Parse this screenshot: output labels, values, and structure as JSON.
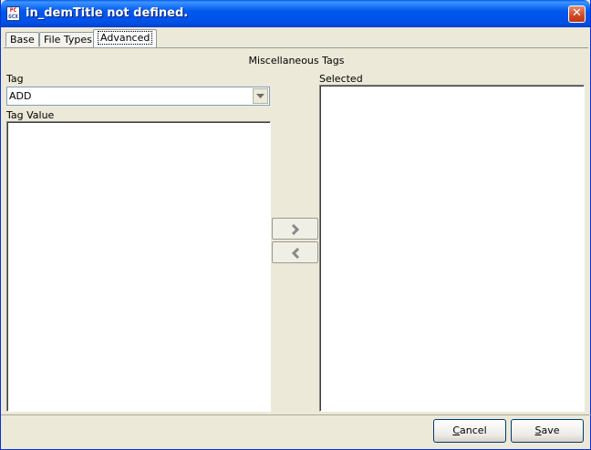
{
  "window": {
    "title": "in_demTitle not defined.",
    "icon_lines": [
      "PC",
      "GCX"
    ],
    "close_glyph": "✕"
  },
  "tabs": [
    {
      "label": "Base",
      "active": false
    },
    {
      "label": "File Types",
      "active": false
    },
    {
      "label": "Advanced",
      "active": true
    }
  ],
  "section": {
    "heading": "Miscellaneous Tags"
  },
  "tag": {
    "label": "Tag",
    "selected": "ADD"
  },
  "tag_value": {
    "label": "Tag Value",
    "value": ""
  },
  "selected_list": {
    "label": "Selected",
    "items": []
  },
  "move": {
    "add_icon": "chevron-right-icon",
    "remove_icon": "chevron-left-icon"
  },
  "buttons": {
    "cancel_mnemonic": "C",
    "cancel_rest": "ancel",
    "save_mnemonic": "S",
    "save_rest": "ave"
  },
  "colors": {
    "titlebar": "#0058ee",
    "window_bg": "#ece9d8",
    "close": "#d04a25"
  }
}
